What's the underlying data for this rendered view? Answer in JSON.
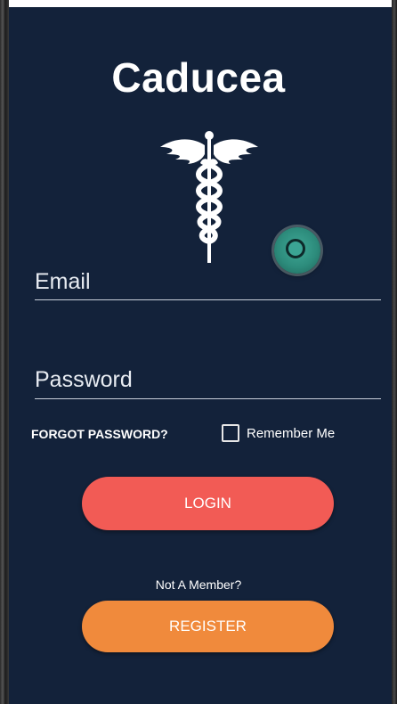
{
  "app": {
    "title": "Caducea",
    "logo_icon": "caduceus-icon"
  },
  "form": {
    "email_label": "Email",
    "password_label": "Password",
    "forgot_password": "FORGOT PASSWORD?",
    "remember_me": "Remember Me",
    "remember_checked": false
  },
  "buttons": {
    "login": "LOGIN",
    "register": "REGISTER"
  },
  "footer": {
    "not_member": "Not A Member?"
  },
  "colors": {
    "background": "#13223a",
    "login_button": "#f25b55",
    "register_button": "#f08a3c",
    "floating_button": "#2d8c7c"
  }
}
